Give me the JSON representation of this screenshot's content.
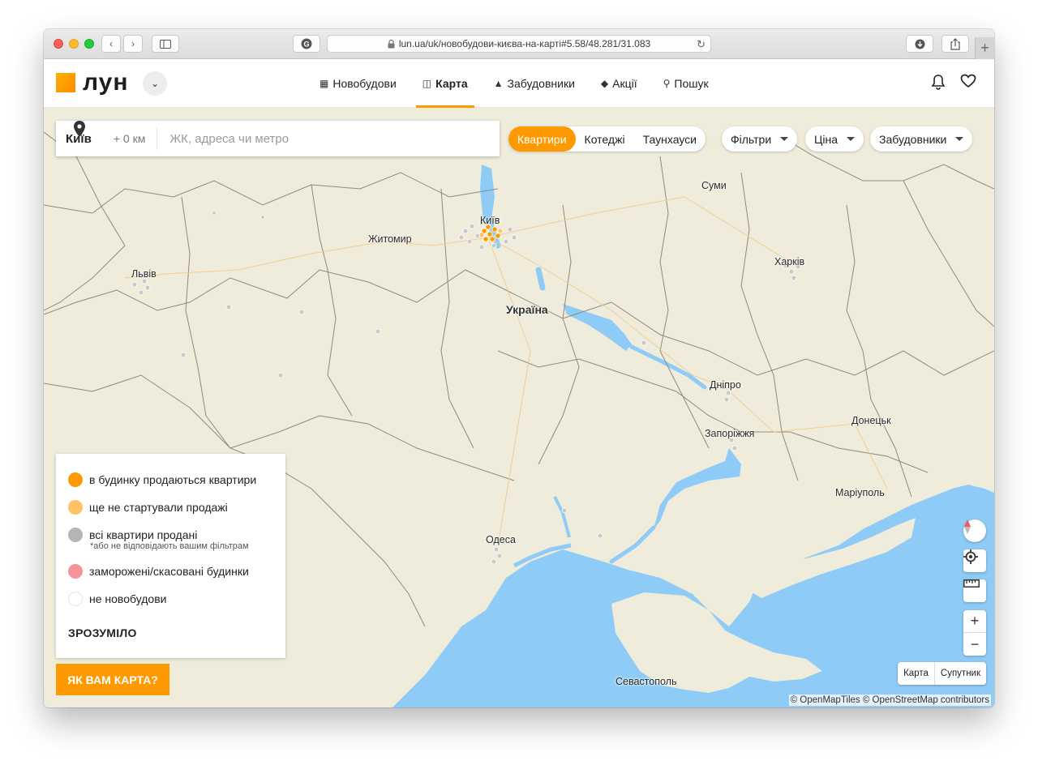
{
  "browser": {
    "url": "lun.ua/uk/новобудови-києва-на-карті#5.58/48.281/31.083",
    "lock_icon": "lock-icon",
    "new_tab": "+"
  },
  "header": {
    "logo": "лун",
    "nav": [
      {
        "label": "Новобудови",
        "icon": "building-icon"
      },
      {
        "label": "Карта",
        "icon": "map-icon",
        "active": true
      },
      {
        "label": "Забудовники",
        "icon": "crane-icon"
      },
      {
        "label": "Акції",
        "icon": "tag-icon"
      },
      {
        "label": "Пошук",
        "icon": "search-icon"
      }
    ]
  },
  "search": {
    "city": "Київ",
    "radius": "+ 0 км",
    "placeholder": "ЖК, адреса чи метро"
  },
  "filters": {
    "types": [
      "Квартири",
      "Котеджі",
      "Таунхауси"
    ],
    "active_type": "Квартири",
    "dropdowns": [
      "Фільтри",
      "Ціна",
      "Забудовники"
    ],
    "accent_color": "#ff9900"
  },
  "map": {
    "country": "Україна",
    "cities": [
      {
        "name": "Житомир"
      },
      {
        "name": "Львів"
      },
      {
        "name": "Суми"
      },
      {
        "name": "Харків"
      },
      {
        "name": "Дніпро"
      },
      {
        "name": "Запоріжжя"
      },
      {
        "name": "Донецьк"
      },
      {
        "name": "Маріуполь"
      },
      {
        "name": "Одеса"
      },
      {
        "name": "Севастополь"
      },
      {
        "name": "Київ"
      }
    ],
    "water_color": "#8ecbf6",
    "land_color": "#f0ecdc"
  },
  "legend": {
    "items": [
      {
        "label": "в будинку продаються квартири",
        "color": "#ff9900"
      },
      {
        "label": "ще не стартували продажі",
        "color": "#ffc266"
      },
      {
        "label": "всі квартири продані",
        "color": "#b5b5b5",
        "note": "*або не відповідають вашим фільтрам"
      },
      {
        "label": "заморожені/скасовані будинки",
        "color": "#f4949a"
      },
      {
        "label": "не новобудови",
        "color": "#ffffff"
      }
    ],
    "ok": "ЗРОЗУМІЛО"
  },
  "feedback": "ЯК ВАМ КАРТА?",
  "layers": [
    "Карта",
    "Супутник"
  ],
  "zoom": {
    "in": "+",
    "out": "−"
  },
  "attribution": "© OpenMapTiles © OpenStreetMap contributors"
}
